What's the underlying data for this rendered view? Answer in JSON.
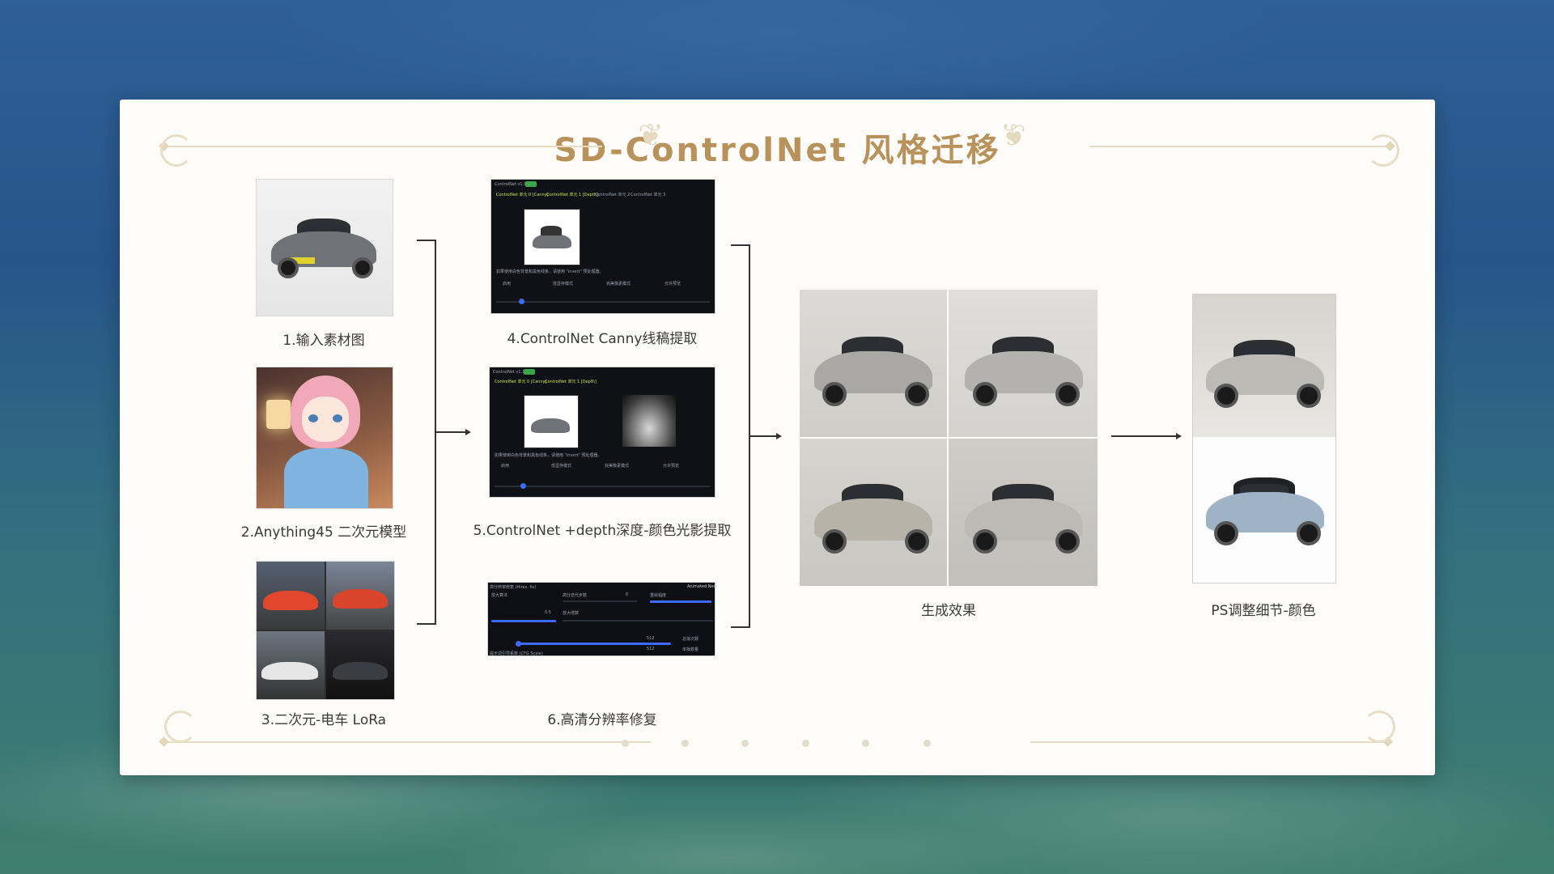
{
  "title": "SD-ControlNet 风格迁移",
  "steps": {
    "s1": "1.输入素材图",
    "s2": "2.Anything45 二次元模型",
    "s3": "3.二次元-电车 LoRa",
    "s4": "4.ControlNet Canny线稿提取",
    "s5": "5.ControlNet +depth深度-颜色光影提取",
    "s6": "6.高清分辨率修复",
    "result": "生成效果",
    "final": "PS调整细节-颜色"
  },
  "controlnet_ui": {
    "header": "ControlNet v1.1.449",
    "badge": "3 units",
    "tab1": "ControlNet 单元 0 [Canny]",
    "tab2": "ControlNet 单元 1 [Depth]",
    "tab3": "ControlNet 单元 2",
    "tab4": "ControlNet 单元 3",
    "enable": "启用",
    "lowvram": "低显存模式",
    "perfect": "完美像素模式",
    "preview": "允许预览",
    "hint": "如果使用白色背景和黑色线条，请使用 \"invert\" 预处理器。"
  },
  "hires_ui": {
    "title": "高分辨率修复 (Hires. fix)",
    "extra": "Animated Next",
    "upscaler": "放大算法",
    "steps": "高分迭代步数",
    "denoise": "重绘幅度",
    "scale": "放大倍数",
    "cfg": "提示词引导系数 (CFG Scale)",
    "v1": "0",
    "v2": "0.5",
    "v3": "512",
    "v4": "512",
    "gen": "总批次数",
    "batch": "单批数量"
  },
  "colors": {
    "title": "#b8925a",
    "accent": "#3b6cff"
  }
}
